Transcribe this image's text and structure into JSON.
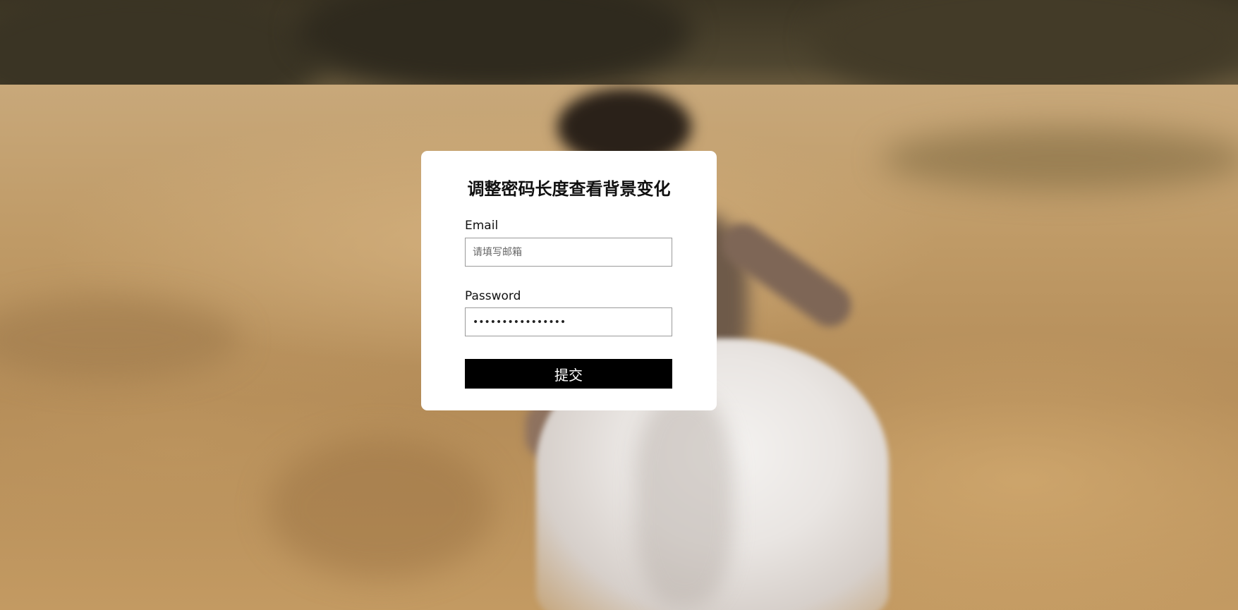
{
  "form": {
    "title": "调整密码长度查看背景变化",
    "email_label": "Email",
    "email_placeholder": "请填写邮箱",
    "email_value": "",
    "password_label": "Password",
    "password_value": "••••••••••••••••",
    "submit_label": "提交"
  },
  "colors": {
    "card_background": "#ffffff",
    "button_background": "#000000",
    "button_text": "#ffffff"
  }
}
